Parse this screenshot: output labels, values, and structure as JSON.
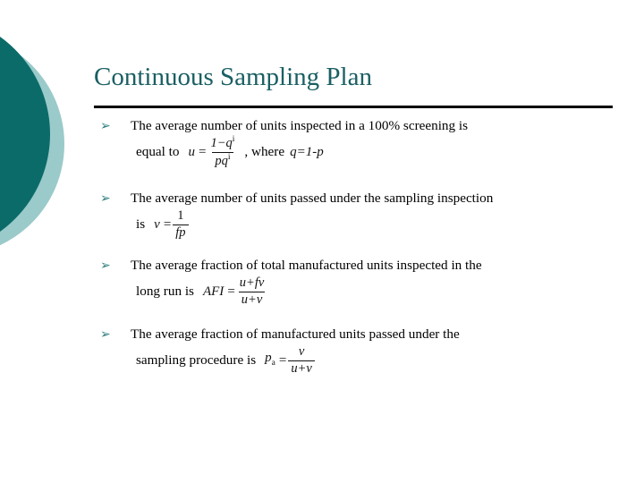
{
  "slide": {
    "title": "Continuous Sampling Plan",
    "colors": {
      "title_teal": "#1a5f63",
      "circle_dark_teal": "#0b6b69",
      "circle_light_teal": "#9bcaca",
      "bullet_marker_teal": "#2e7d7d",
      "body_text": "#000000",
      "rule": "#000000",
      "background": "#ffffff"
    },
    "bullet_marker_glyph": "➢"
  },
  "bullets": [
    {
      "line1": "The average number of units inspected in a 100% screening  is",
      "line2_prefix": "equal to",
      "formula": {
        "lhs": "u",
        "eq": "=",
        "numerator": "1−q",
        "numerator_sup": "i",
        "denominator": "pq",
        "denominator_sup": "i"
      },
      "line2_suffix": ", where",
      "condition": "q=1-p"
    },
    {
      "line1": "The average number of units passed under the sampling inspection",
      "line2_prefix": "is",
      "formula": {
        "lhs": "v",
        "eq": "=",
        "numerator": "1",
        "denominator": "fp"
      }
    },
    {
      "line1": "The average fraction of total manufactured units inspected in the",
      "line2_prefix": "long run is",
      "formula": {
        "lhs": "AFI",
        "eq": "=",
        "numerator": "u+fv",
        "denominator": "u+v"
      }
    },
    {
      "line1": "The average fraction of manufactured units passed under the",
      "line2_prefix": "sampling procedure is",
      "formula": {
        "lhs": "p",
        "lhs_sub": "a",
        "eq": "=",
        "numerator": "v",
        "denominator": "u+v"
      }
    }
  ]
}
